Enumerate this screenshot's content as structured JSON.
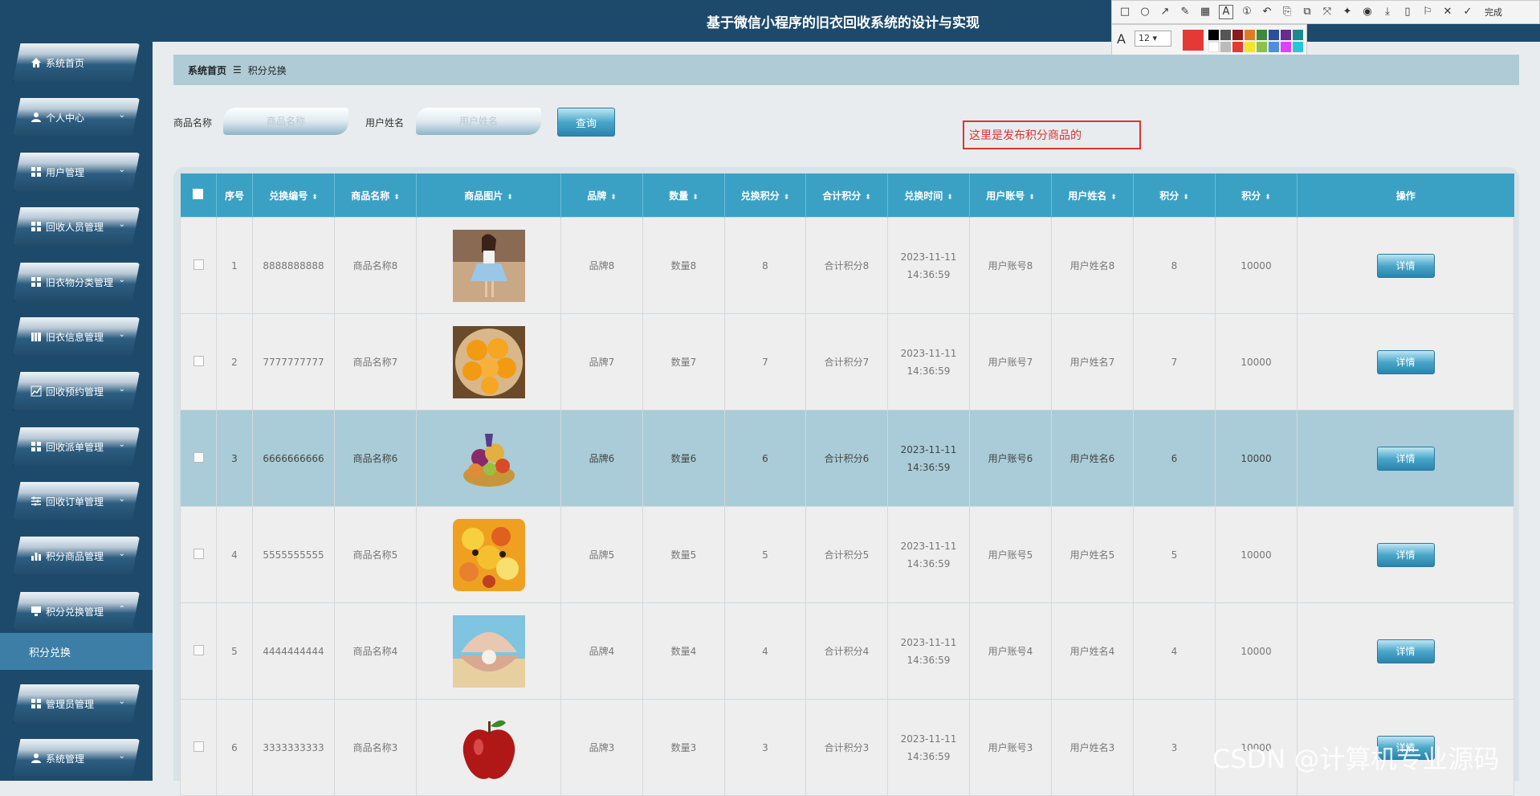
{
  "app": {
    "title": "基于微信小程序的旧衣回收系统的设计与实现"
  },
  "sidebar": {
    "items": [
      {
        "label": "系统首页",
        "icon": "home-icon"
      },
      {
        "label": "个人中心",
        "icon": "user-icon"
      },
      {
        "label": "用户管理",
        "icon": "grid-icon"
      },
      {
        "label": "回收人员管理",
        "icon": "grid-icon"
      },
      {
        "label": "旧衣物分类管理",
        "icon": "grid-icon"
      },
      {
        "label": "旧衣信息管理",
        "icon": "book-icon"
      },
      {
        "label": "回收预约管理",
        "icon": "chart-icon"
      },
      {
        "label": "回收派单管理",
        "icon": "grid-icon"
      },
      {
        "label": "回收订单管理",
        "icon": "sliders-icon"
      },
      {
        "label": "积分商品管理",
        "icon": "bar-chart-icon"
      },
      {
        "label": "积分兑换管理",
        "icon": "monitor-icon"
      },
      {
        "label": "管理员管理",
        "icon": "grid-icon"
      },
      {
        "label": "系统管理",
        "icon": "user-icon"
      }
    ],
    "sub_item": "积分兑换"
  },
  "breadcrumb": {
    "home": "系统首页",
    "separator": "☰",
    "current": "积分兑换"
  },
  "search": {
    "product_label": "商品名称",
    "product_placeholder": "商品名称",
    "user_label": "用户姓名",
    "user_placeholder": "用户姓名",
    "button": "查询"
  },
  "annotation": "这里是发布积分商品的",
  "toolbar": {
    "font_size": "12",
    "done_label": "完成"
  },
  "table": {
    "headers": [
      "序号",
      "兑换编号",
      "商品名称",
      "商品图片",
      "品牌",
      "数量",
      "兑换积分",
      "合计积分",
      "兑换时间",
      "用户账号",
      "用户姓名",
      "积分",
      "积分",
      "操作"
    ],
    "rows": [
      {
        "no": "1",
        "code": "8888888888",
        "name": "商品名称8",
        "img": "dress",
        "brand": "品牌8",
        "qty": "数量8",
        "points": "8",
        "total": "合计积分8",
        "time": "2023-11-11 14:36:59",
        "account": "用户账号8",
        "uname": "用户姓名8",
        "p1": "8",
        "p2": "10000",
        "action": "详情"
      },
      {
        "no": "2",
        "code": "7777777777",
        "name": "商品名称7",
        "img": "oranges",
        "brand": "品牌7",
        "qty": "数量7",
        "points": "7",
        "total": "合计积分7",
        "time": "2023-11-11 14:36:59",
        "account": "用户账号7",
        "uname": "用户姓名7",
        "p1": "7",
        "p2": "10000",
        "action": "详情"
      },
      {
        "no": "3",
        "code": "6666666666",
        "name": "商品名称6",
        "img": "fruit-basket",
        "brand": "品牌6",
        "qty": "数量6",
        "points": "6",
        "total": "合计积分6",
        "time": "2023-11-11 14:36:59",
        "account": "用户账号6",
        "uname": "用户姓名6",
        "p1": "6",
        "p2": "10000",
        "action": "详情"
      },
      {
        "no": "4",
        "code": "5555555555",
        "name": "商品名称5",
        "img": "fruit-platter",
        "brand": "品牌5",
        "qty": "数量5",
        "points": "5",
        "total": "合计积分5",
        "time": "2023-11-11 14:36:59",
        "account": "用户账号5",
        "uname": "用户姓名5",
        "p1": "5",
        "p2": "10000",
        "action": "详情"
      },
      {
        "no": "5",
        "code": "4444444444",
        "name": "商品名称4",
        "img": "pearl-shell",
        "brand": "品牌4",
        "qty": "数量4",
        "points": "4",
        "total": "合计积分4",
        "time": "2023-11-11 14:36:59",
        "account": "用户账号4",
        "uname": "用户姓名4",
        "p1": "4",
        "p2": "10000",
        "action": "详情"
      },
      {
        "no": "6",
        "code": "3333333333",
        "name": "商品名称3",
        "img": "apple",
        "brand": "品牌3",
        "qty": "数量3",
        "points": "3",
        "total": "合计积分3",
        "time": "2023-11-11 14:36:59",
        "account": "用户账号3",
        "uname": "用户姓名3",
        "p1": "3",
        "p2": "10000",
        "action": "详情"
      }
    ]
  },
  "watermark": "CSDN @计算机专业源码"
}
